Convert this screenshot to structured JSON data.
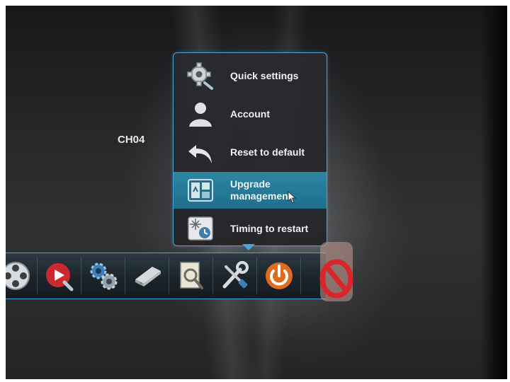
{
  "screen": {
    "channel_label": "CH04"
  },
  "menu": {
    "items": [
      {
        "label": "Quick settings",
        "icon": "gear-wrench-icon",
        "active": false
      },
      {
        "label": "Account",
        "icon": "user-icon",
        "active": false
      },
      {
        "label": "Reset to default",
        "icon": "undo-arrow-icon",
        "active": false
      },
      {
        "label": "Upgrade management",
        "icon": "upgrade-chip-icon",
        "active": true
      },
      {
        "label": "Timing to restart",
        "icon": "timer-restart-icon",
        "active": false
      }
    ]
  },
  "taskbar": {
    "buttons": [
      {
        "icon": "film-reel-icon"
      },
      {
        "icon": "playback-icon"
      },
      {
        "icon": "system-gears-icon"
      },
      {
        "icon": "hard-disk-icon"
      },
      {
        "icon": "search-document-icon"
      },
      {
        "icon": "tools-icon"
      },
      {
        "icon": "power-icon"
      }
    ]
  },
  "colors": {
    "accent_border": "#4aa6d9",
    "active_item": "#2a86a4",
    "power_orange": "#e06a1e",
    "stop_red": "#d9262a"
  }
}
